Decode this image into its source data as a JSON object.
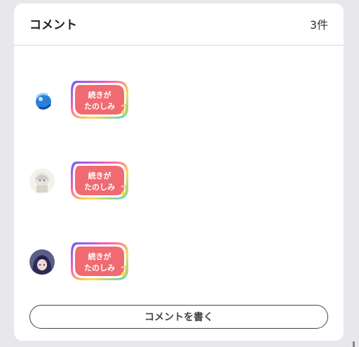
{
  "header": {
    "title": "コメント",
    "count": "3件"
  },
  "comments": [
    {
      "avatar_icon": "avatar-blue-orb-icon",
      "sticker_icon": "sticker-looking-forward-icon",
      "sticker_text": [
        "続きが",
        "たのしみ"
      ]
    },
    {
      "avatar_icon": "avatar-white-hair-character-icon",
      "sticker_icon": "sticker-looking-forward-icon",
      "sticker_text": [
        "続きが",
        "たのしみ"
      ]
    },
    {
      "avatar_icon": "avatar-dark-hair-character-icon",
      "sticker_icon": "sticker-looking-forward-icon",
      "sticker_text": [
        "続きが",
        "たのしみ"
      ]
    }
  ],
  "actions": {
    "write_comment_label": "コメントを書く"
  },
  "colors": {
    "sticker_fill": "#f06a72",
    "accent_border": "#ffffff",
    "button_border": "#444444"
  }
}
